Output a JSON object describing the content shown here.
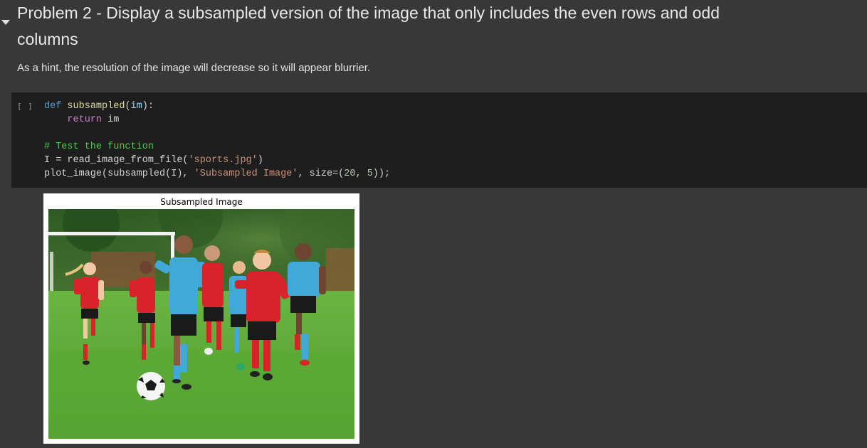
{
  "text_cell": {
    "heading": "Problem 2 - Display a subsampled version of the image that only includes the even rows and odd columns",
    "hint": "As a hint, the resolution of the image will decrease so it will appear blurrier.",
    "collapse_icon": "caret-down-icon"
  },
  "code_cell": {
    "run_indicator": "[ ]",
    "tokens": {
      "def": "def",
      "func_name": "subsampled",
      "paren_open": "(",
      "param": "im",
      "paren_close_colon": "):",
      "return_kw": "return",
      "return_val": " im",
      "comment": "# Test the function",
      "assign_prefix": "I = read_image_from_file(",
      "filename": "'sports.jpg'",
      "assign_suffix": ")",
      "call_prefix": "plot_image(subsampled(I), ",
      "title_str": "'Subsampled Image'",
      "size_prefix": ", size=(",
      "size_w": "20",
      "comma": ", ",
      "size_h": "5",
      "call_suffix": "));"
    }
  },
  "output": {
    "figure_title": "Subsampled Image",
    "image_alt": "kids playing soccer on grass"
  },
  "colors": {
    "page_bg": "#383838",
    "code_bg": "#1e1e1e",
    "jersey_red": "#d8232a",
    "jersey_blue": "#3fa9d8",
    "grass": "#5fae3a"
  }
}
